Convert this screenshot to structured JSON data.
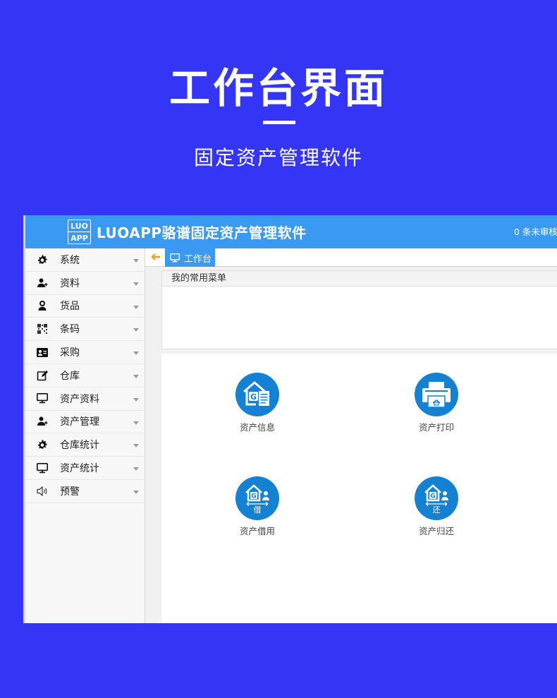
{
  "hero": {
    "title": "工作台界面",
    "subtitle": "固定资产管理软件"
  },
  "app": {
    "logo_top": "LUO",
    "logo_bottom": "APP",
    "title": "LUOAPP骆谱固定资产管理软件",
    "notice": "0 条未审核",
    "header_color": "#3a9af1"
  },
  "sidebar": {
    "items": [
      {
        "label": "系统",
        "icon": "gear-icon"
      },
      {
        "label": "资料",
        "icon": "user-add-icon"
      },
      {
        "label": "货品",
        "icon": "person-icon"
      },
      {
        "label": "条码",
        "icon": "qrcode-icon"
      },
      {
        "label": "采购",
        "icon": "id-card-icon"
      },
      {
        "label": "仓库",
        "icon": "edit-icon"
      },
      {
        "label": "资产资料",
        "icon": "monitor-icon"
      },
      {
        "label": "资产管理",
        "icon": "user-add-icon"
      },
      {
        "label": "仓库统计",
        "icon": "gear-icon"
      },
      {
        "label": "资产统计",
        "icon": "monitor-icon"
      },
      {
        "label": "预警",
        "icon": "speaker-icon"
      }
    ]
  },
  "tabs": {
    "active_label": "工作台"
  },
  "favorites": {
    "header": "我的常用菜单"
  },
  "tiles": [
    {
      "label": "资产信息",
      "icon": "asset-info-icon"
    },
    {
      "label": "资产打印",
      "icon": "printer-icon"
    },
    {
      "label": "资产借用",
      "icon": "asset-borrow-icon",
      "glyph": "借"
    },
    {
      "label": "资产归还",
      "icon": "asset-return-icon",
      "glyph": "还"
    }
  ],
  "colors": {
    "page_background": "#3536f5",
    "accent": "#3a9af1",
    "tile_circle": "#1581d2",
    "back_arrow": "#f39a1e"
  }
}
